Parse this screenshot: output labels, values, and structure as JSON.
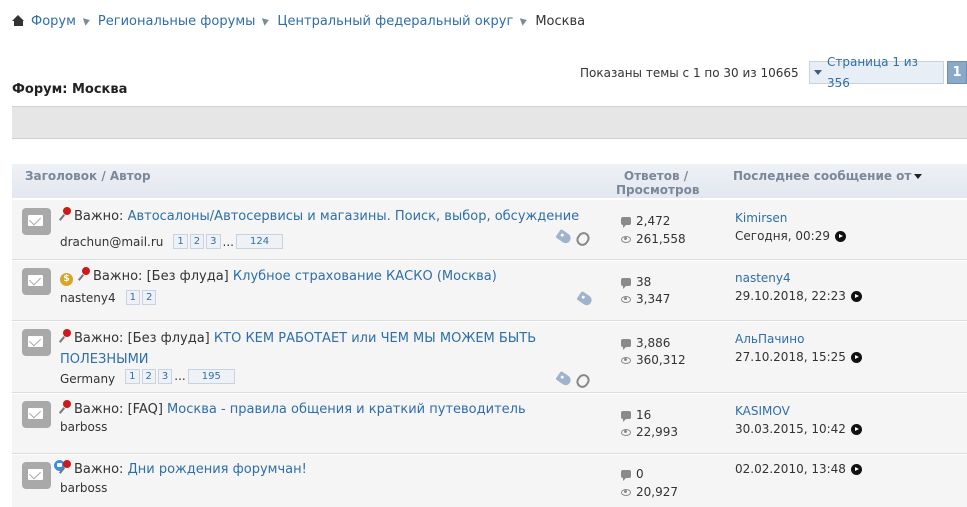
{
  "breadcrumb": {
    "items": [
      "Форум",
      "Региональные форумы",
      "Центральный федеральный округ"
    ],
    "current": "Москва"
  },
  "forum": {
    "title": "Форум: Москва"
  },
  "pagination": {
    "threads_info": "Показаны темы с 1 по 30 из 10665",
    "page_label": "Страница 1 из 356",
    "current_page": "1"
  },
  "list_header": {
    "title_author": "Заголовок / Автор",
    "stats_line1": "Ответов /",
    "stats_line2": "Просмотров",
    "last_post": "Последнее сообщение от"
  },
  "threads": [
    {
      "prefix": "Важно:",
      "prefix2": "",
      "title": "Автосалоны/Автосервисы и магазины. Поиск, выбор, обсуждение",
      "author": "drachun@mail.ru",
      "pages": [
        "1",
        "2",
        "3",
        "124"
      ],
      "replies": "2,472",
      "views": "261,558",
      "last_user": "Kimirsen",
      "last_date": "Сегодня, 00:29"
    },
    {
      "prefix": "Важно:",
      "prefix2": "[Без флуда]",
      "title": "Клубное страхование КАСКО (Москва)",
      "author": "nasteny4",
      "pages": [
        "1",
        "2"
      ],
      "replies": "38",
      "views": "3,347",
      "last_user": "nasteny4",
      "last_date": "29.10.2018, 22:23"
    },
    {
      "prefix": "Важно:",
      "prefix2": "[Без флуда]",
      "title": "КТО КЕМ РАБОТАЕТ или ЧЕМ МЫ МОЖЕМ БЫТЬ ПОЛЕЗНЫМИ",
      "author": "Germany",
      "pages": [
        "1",
        "2",
        "3",
        "195"
      ],
      "replies": "3,886",
      "views": "360,312",
      "last_user": "АльПачино",
      "last_date": "27.10.2018, 15:25"
    },
    {
      "prefix": "Важно:",
      "prefix2": "[FAQ]",
      "title": "Москва - правила общения и краткий путеводитель",
      "author": "barboss",
      "pages": [],
      "replies": "16",
      "views": "22,993",
      "last_user": "KASIMOV",
      "last_date": "30.03.2015, 10:42"
    },
    {
      "prefix": "Важно:",
      "prefix2": "",
      "title": "Дни рождения форумчан!",
      "author": "barboss",
      "pages": [],
      "replies": "0",
      "views": "20,927",
      "last_user": "",
      "last_date": "02.02.2010, 13:48"
    }
  ]
}
